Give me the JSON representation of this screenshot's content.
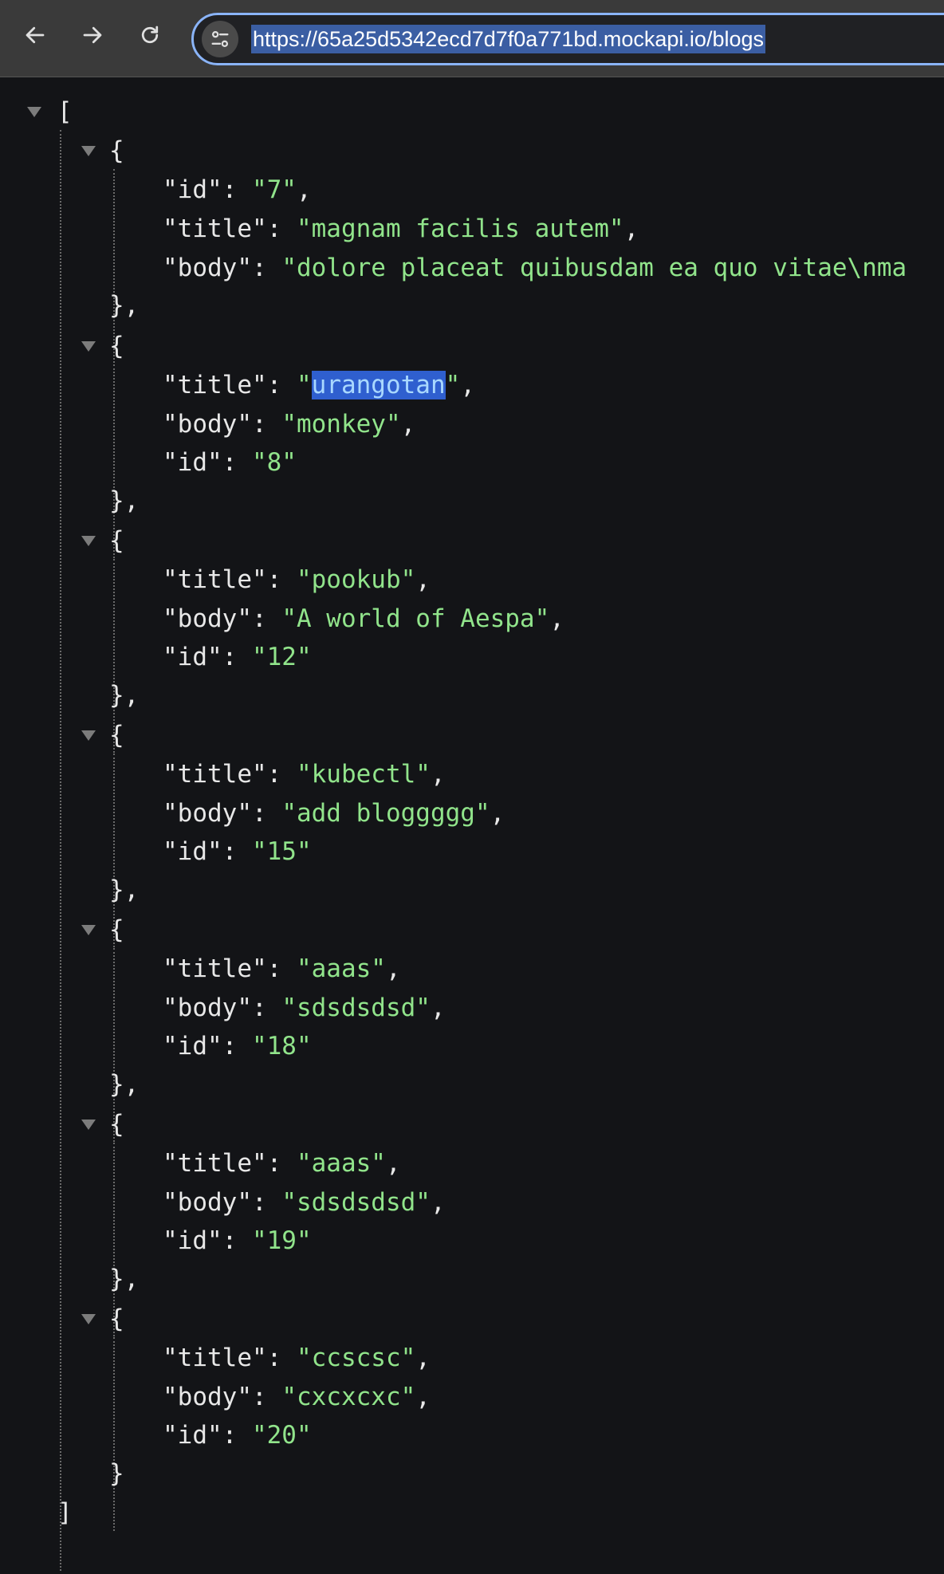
{
  "browser": {
    "url": "https://65a25d5342ecd7d7f0a771bd.mockapi.io/blogs",
    "back_icon": "arrow-left-icon",
    "forward_icon": "arrow-right-icon",
    "reload_icon": "reload-icon",
    "site_info_icon": "tune-icon"
  },
  "json_viewer": {
    "open_bracket": "[",
    "close_bracket": "]",
    "open_brace": "{",
    "close_brace": "},",
    "last_close_brace": "}",
    "selected_text": "urangotan",
    "records": [
      {
        "fields": [
          {
            "key": "\"id\"",
            "value": "\"7\"",
            "comma": ","
          },
          {
            "key": "\"title\"",
            "value": "\"magnam facilis autem\"",
            "comma": ","
          },
          {
            "key": "\"body\"",
            "value": "\"dolore placeat quibusdam ea quo vitae\\nma",
            "comma": ""
          }
        ]
      },
      {
        "fields": [
          {
            "key": "\"title\"",
            "value": "\"urangotan\"",
            "comma": ","
          },
          {
            "key": "\"body\"",
            "value": "\"monkey\"",
            "comma": ","
          },
          {
            "key": "\"id\"",
            "value": "\"8\"",
            "comma": ""
          }
        ]
      },
      {
        "fields": [
          {
            "key": "\"title\"",
            "value": "\"pookub\"",
            "comma": ","
          },
          {
            "key": "\"body\"",
            "value": "\"A world of Aespa\"",
            "comma": ","
          },
          {
            "key": "\"id\"",
            "value": "\"12\"",
            "comma": ""
          }
        ]
      },
      {
        "fields": [
          {
            "key": "\"title\"",
            "value": "\"kubectl\"",
            "comma": ","
          },
          {
            "key": "\"body\"",
            "value": "\"add bloggggg\"",
            "comma": ","
          },
          {
            "key": "\"id\"",
            "value": "\"15\"",
            "comma": ""
          }
        ]
      },
      {
        "fields": [
          {
            "key": "\"title\"",
            "value": "\"aaas\"",
            "comma": ","
          },
          {
            "key": "\"body\"",
            "value": "\"sdsdsdsd\"",
            "comma": ","
          },
          {
            "key": "\"id\"",
            "value": "\"18\"",
            "comma": ""
          }
        ]
      },
      {
        "fields": [
          {
            "key": "\"title\"",
            "value": "\"aaas\"",
            "comma": ","
          },
          {
            "key": "\"body\"",
            "value": "\"sdsdsdsd\"",
            "comma": ","
          },
          {
            "key": "\"id\"",
            "value": "\"19\"",
            "comma": ""
          }
        ]
      },
      {
        "fields": [
          {
            "key": "\"title\"",
            "value": "\"ccscsc\"",
            "comma": ","
          },
          {
            "key": "\"body\"",
            "value": "\"cxcxcxc\"",
            "comma": ","
          },
          {
            "key": "\"id\"",
            "value": "\"20\"",
            "comma": ""
          }
        ]
      }
    ]
  }
}
